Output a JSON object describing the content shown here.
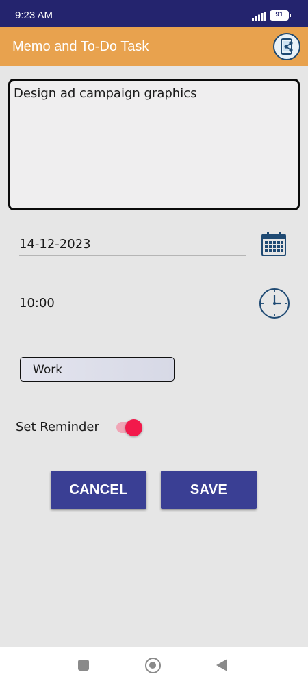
{
  "status_bar": {
    "time": "9:23 AM",
    "battery": "91",
    "icons": [
      "signal-icon",
      "battery-icon"
    ]
  },
  "app_bar": {
    "title": "Memo and To-Do Task",
    "share_icon": "share-icon",
    "color": "#e8a24e"
  },
  "memo": {
    "text": "Design ad campaign graphics"
  },
  "date_field": {
    "value": "14-12-2023",
    "icon": "calendar-icon"
  },
  "time_field": {
    "value": "10:00",
    "icon": "clock-icon"
  },
  "category": {
    "selected": "Work"
  },
  "reminder": {
    "label": "Set Reminder",
    "enabled": true,
    "accent": "#f2194b"
  },
  "actions": {
    "cancel_label": "CANCEL",
    "save_label": "SAVE",
    "color": "#3a3f94"
  },
  "nav": {
    "icons": [
      "recents-icon",
      "home-icon",
      "back-icon"
    ]
  }
}
